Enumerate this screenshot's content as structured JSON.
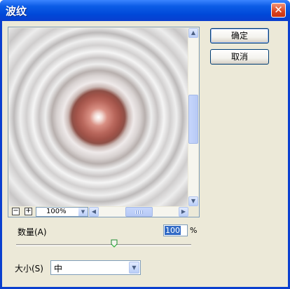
{
  "window": {
    "title": "波纹"
  },
  "title_bar": {
    "close_symbol": "✕"
  },
  "buttons": {
    "ok_label": "确定",
    "cancel_label": "取消"
  },
  "preview": {
    "zoom_out_symbol": "−",
    "zoom_in_symbol": "+",
    "zoom_value": "100%",
    "scroll_up": "▲",
    "scroll_down": "▼",
    "scroll_left": "◀",
    "scroll_right": "▶",
    "dropdown_arrow": "▼"
  },
  "amount": {
    "label": "数量(A)",
    "value": "100",
    "unit": "%",
    "slider_fraction": 0.56
  },
  "size": {
    "label": "大小(S)",
    "selected": "中",
    "dropdown_arrow": "▼"
  },
  "colors": {
    "title_bar": "#0a3fcf",
    "dialog_bg": "#ece9d8",
    "close_button": "#d9431f",
    "selection": "#316ac5"
  }
}
